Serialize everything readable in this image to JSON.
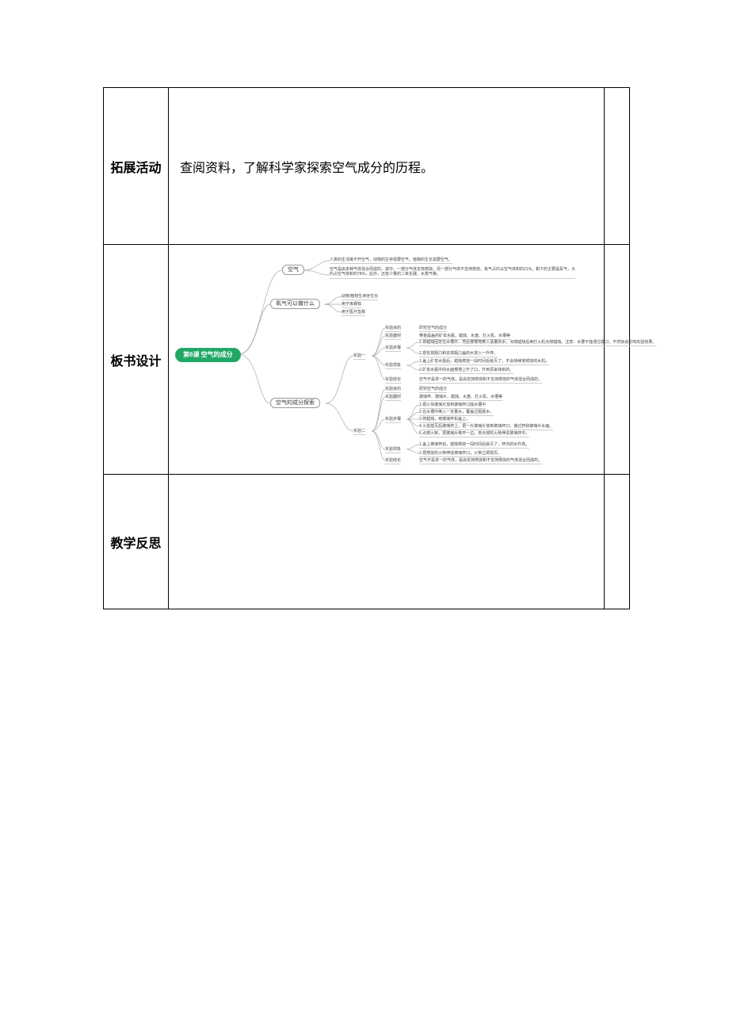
{
  "rows": {
    "extension_label": "拓展活动",
    "extension_content": "查阅资料，了解科学家探索空气成分的历程。",
    "board_label": "板书设计",
    "reflection_label": "教学反思"
  },
  "mindmap": {
    "root": "第6课 空气的成分",
    "branch1": {
      "title": "空气",
      "leaves": [
        "人类的生活离不开空气，动物的生存需要空气，植物的生长需要空气。",
        "空气是由多种气体混合而成的。其中，一部分气体支持燃烧，另一部分气体不支持燃烧。氧气占约占空气体积的21%，剩下的主要是氮气，大约占空气体积的78%，此外，还有少量的二氧化碳、水蒸气等。"
      ]
    },
    "branch2": {
      "title": "氧气可以做什么",
      "leaves": [
        "动物/植物生命存生长",
        "用于炼钢铁",
        "用于医疗急救"
      ]
    },
    "branch3": {
      "title": "空气的成分探索",
      "exp1": {
        "title": "实验一",
        "items": {
          "aim_label": "实验目的",
          "aim_text": "研究空气的成分",
          "mat_label": "实验器材",
          "mat_text": "带金属盖的矿泉水瓶、蜡烛、水盘、打火机、水槽等",
          "step_label": "实验步骤",
          "steps": [
            "1.将蜡烛固定在水槽中，然后慢慢地倒入适量的水，点燃蜡烛后用打火机点燃蜡烛。注意：水要不能漫过瓶口，不然就会影响实验效果。",
            "2.把去掉瓶口和去掉瓶口盖的水放入一升杯。"
          ],
          "phen_label": "实验现象",
          "phens": [
            "1.盖上矿泉水瓶后，蜡烛燃烧一段时间后就灭了，不会持续地燃烧的水机。",
            "2.矿泉水瓶中的水面慢慢上升了口，升到原来体积的。"
          ],
          "concl_label": "实验结论",
          "concl_text": "空气不是单一的气体，是由支持燃烧和不支持燃烧的气体混合而成的。"
        }
      },
      "exp2": {
        "title": "实验二",
        "items": {
          "aim_label": "实验目的",
          "aim_text": "研究空气的成分",
          "mat_label": "实验器材",
          "mat_text": "玻璃杯、玻璃片、蜡烛、水盘、打火机、水槽等",
          "step_label": "实验步骤",
          "steps": [
            "1.把小块玻璃片放到玻璃杯口底水槽中",
            "2.在水槽中倒入一定量水，覆盖过瓶底水。",
            "3.将蜡烛，用玻璃杯扣盖上。",
            "4.火焰熄灭后玻璃杯上，把一片玻璃片放到玻璃杯口，接过杯和玻璃片水面。",
            "5.点燃火柴，把玻璃片移开一边，将点燃的火柴伸进玻璃杯中。"
          ],
          "phen_label": "实验现象",
          "phens": [
            "1.盖上玻璃杯后，蜡烛燃烧一段时间后就灭了，杯内的水升高。",
            "2.把燃烧的火柴伸进玻璃杯口，火柴立即熄灭。"
          ],
          "concl_label": "实验结论",
          "concl_text": "空气不是单一的气体，是由支持燃烧和不支持燃烧的气体混合而成的。"
        }
      }
    }
  }
}
